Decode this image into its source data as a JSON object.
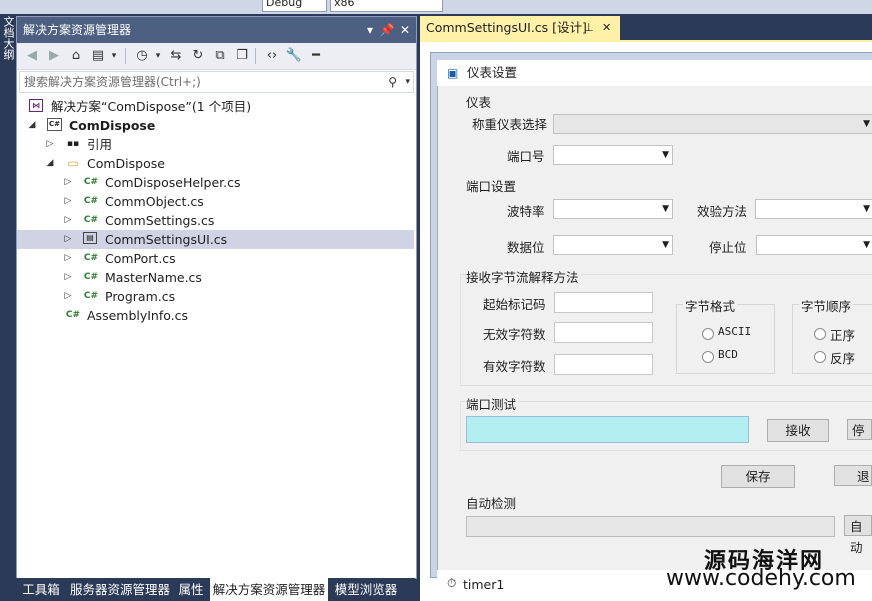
{
  "toolbar": {
    "config_combo": "Debug",
    "platform_combo": "x86"
  },
  "left_vertical_tab": "文档大纲",
  "solution_explorer": {
    "title": "解决方案资源管理器",
    "pin_glyph": "⊥",
    "search_placeholder": "搜索解决方案资源管理器(Ctrl+;)",
    "tree": [
      {
        "label": "解决方案“ComDispose”(1 个项目)",
        "icon": "solution-icon",
        "bold": false
      },
      {
        "label": "ComDispose",
        "icon": "csharp-project-icon",
        "bold": true
      },
      {
        "label": "引用",
        "icon": "references-icon",
        "bold": false
      },
      {
        "label": "ComDispose",
        "icon": "folder-icon",
        "bold": false
      },
      {
        "label": "ComDisposeHelper.cs",
        "icon": "csharp-file-icon",
        "bold": false
      },
      {
        "label": "CommObject.cs",
        "icon": "csharp-file-icon",
        "bold": false
      },
      {
        "label": "CommSettings.cs",
        "icon": "csharp-file-icon",
        "bold": false
      },
      {
        "label": "CommSettingsUI.cs",
        "icon": "form-file-icon",
        "bold": false,
        "selected": true
      },
      {
        "label": "ComPort.cs",
        "icon": "csharp-file-icon",
        "bold": false
      },
      {
        "label": "MasterName.cs",
        "icon": "csharp-file-icon",
        "bold": false
      },
      {
        "label": "Program.cs",
        "icon": "csharp-file-icon",
        "bold": false
      },
      {
        "label": "AssemblyInfo.cs",
        "icon": "csharp-file-icon",
        "bold": false
      }
    ]
  },
  "bottom_tabs": [
    "工具箱",
    "服务器资源管理器",
    "属性",
    "解决方案资源管理器",
    "模型浏览器"
  ],
  "document_tab": {
    "label": "CommSettingsUI.cs [设计]"
  },
  "form": {
    "title": "仪表设置",
    "group_meter": "仪表",
    "label_meter_select": "称重仪表选择",
    "label_port": "端口号",
    "group_port_settings": "端口设置",
    "label_baud": "波特率",
    "label_parity": "效验方法",
    "label_databits": "数据位",
    "label_stopbits": "停止位",
    "group_parse": "接收字节流解释方法",
    "label_start_marker": "起始标记码",
    "label_invalid_chars": "无效字符数",
    "label_valid_chars": "有效字符数",
    "group_byte_format": "字节格式",
    "radio_ascii": "ASCII",
    "radio_bcd": "BCD",
    "group_byte_order": "字节顺序",
    "radio_forward": "正序",
    "radio_reverse": "反序",
    "group_port_test": "端口测试",
    "button_receive": "接收",
    "button_stop_partial": "停",
    "button_save": "保存",
    "button_exit_partial": "退",
    "group_auto_detect": "自动检测",
    "button_auto_partial": "自动",
    "colors": {
      "test_box": "#b2eef0",
      "panel_bg": "#f0f0f0"
    }
  },
  "component_tray": {
    "timer": "timer1"
  },
  "watermark": {
    "line1": "源码海洋网",
    "line2": "www.codehy.com"
  }
}
